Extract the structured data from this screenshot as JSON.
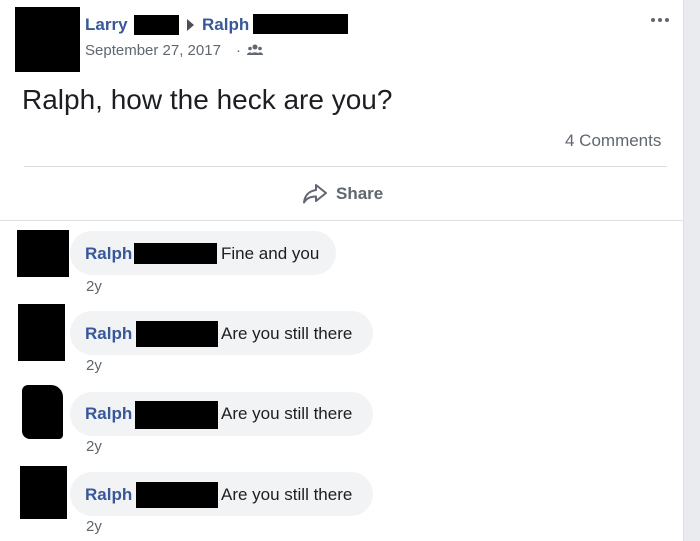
{
  "post": {
    "author": "Larry",
    "recipient": "Ralph",
    "date": "September 27, 2017",
    "separator": "·",
    "audience_icon": "friends-icon",
    "text": "Ralph, how the heck are you?",
    "comment_count": "4 Comments",
    "share_label": "Share"
  },
  "comments": [
    {
      "name": "Ralph",
      "text": "Fine and you",
      "time": "2y"
    },
    {
      "name": "Ralph",
      "text": "Are you still there",
      "time": "2y"
    },
    {
      "name": "Ralph",
      "text": "Are you still there",
      "time": "2y"
    },
    {
      "name": "Ralph",
      "text": "Are you still there",
      "time": "2y"
    }
  ],
  "colors": {
    "link": "#385898",
    "meta": "#606770",
    "bubble": "#f2f3f5",
    "redaction": "#000000"
  }
}
